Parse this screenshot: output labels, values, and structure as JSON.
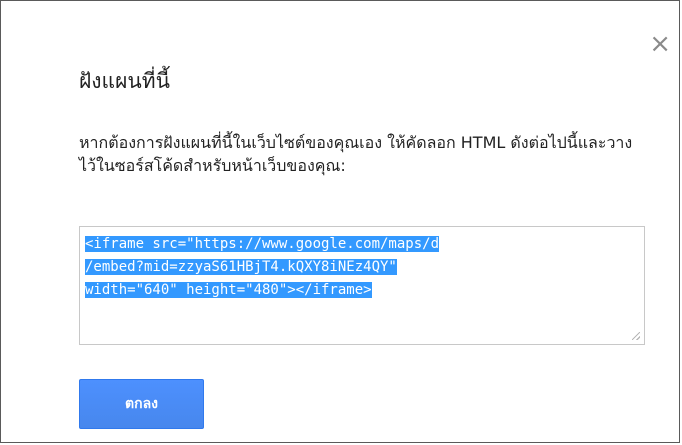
{
  "dialog": {
    "title": "ฝังแผนที่นี้",
    "close_glyph": "×",
    "description": "หากต้องการฝังแผนที่นี้ในเว็บไซต์ของคุณเอง ให้คัดลอก HTML ดังต่อไปนี้และวางไว้ในซอร์สโค้ดสำหรับหน้าเว็บของคุณ:",
    "embed_code_lines": [
      "<iframe src=\"https://www.google.com/maps/d",
      "/embed?mid=zzyaS61HBjT4.kQXY8iNEz4QY\"",
      "width=\"640\" height=\"480\"></iframe>"
    ],
    "ok_label": "ตกลง"
  },
  "colors": {
    "accent": "#4d90fe",
    "selection": "#3399ff"
  },
  "icons": {
    "close": "close-icon",
    "resize": "resize-grip-icon"
  }
}
